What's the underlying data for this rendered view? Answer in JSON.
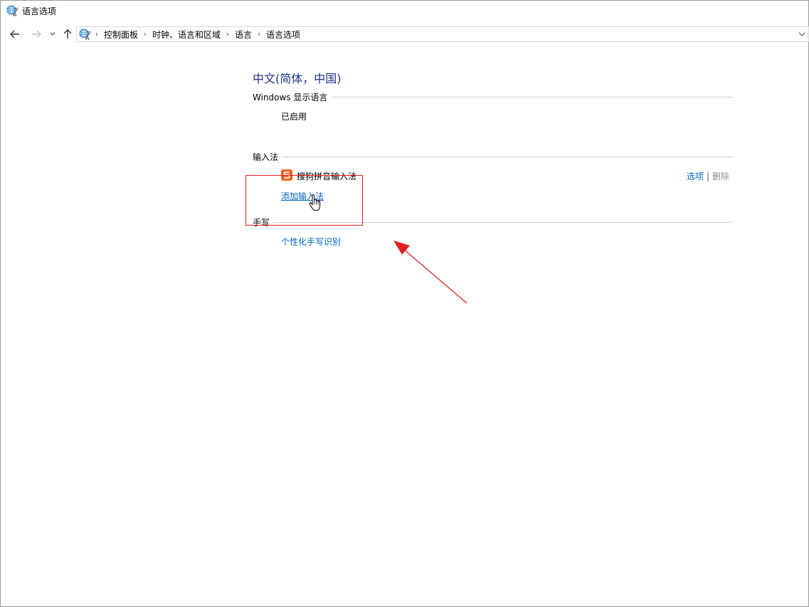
{
  "window": {
    "title": "语言选项"
  },
  "nav": {
    "back_icon": "arrow-left-icon",
    "forward_icon": "arrow-right-icon",
    "recent_icon": "chevron-down-icon",
    "up_icon": "arrow-up-icon"
  },
  "breadcrumb": {
    "items": [
      "控制面板",
      "时钟、语言和区域",
      "语言",
      "语言选项"
    ]
  },
  "language": {
    "title": "中文(简体，中国)"
  },
  "display_language": {
    "section_label": "Windows 显示语言",
    "status": "已启用"
  },
  "input_method": {
    "section_label": "输入法",
    "items": [
      {
        "name": "搜狗拼音输入法",
        "options_label": "选项",
        "separator": "|",
        "delete_label": "删除"
      }
    ],
    "add_label": "添加输入法"
  },
  "handwriting": {
    "section_label": "手写",
    "personalize_label": "个性化手写识别"
  },
  "colors": {
    "title_blue": "#1e3287",
    "link_blue": "#0066cc",
    "annotation_red": "#e02020",
    "ime_orange": "#f26522"
  }
}
